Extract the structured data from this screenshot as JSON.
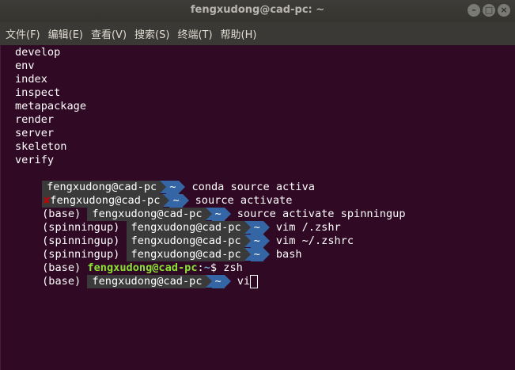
{
  "window": {
    "title": "fengxudong@cad-pc: ~",
    "controls": [
      "–",
      "□",
      "×"
    ]
  },
  "menu": {
    "items": [
      "文件(F)",
      "编辑(E)",
      "查看(V)",
      "搜索(S)",
      "终端(T)",
      "帮助(H)"
    ]
  },
  "terminal": {
    "list_lines": [
      "develop",
      "env",
      "index",
      "inspect",
      "metapackage",
      "render",
      "server",
      "skeleton",
      "verify"
    ],
    "prompt_host": "fengxudong@cad-pc",
    "prompt_dir": "~",
    "error_mark": "✘",
    "plain_prompt_sep": ":",
    "plain_prompt_suffix": "$",
    "cmd1": "conda source activa",
    "cmd2": "source activate",
    "env_base": "(base)",
    "cmd3": "source activate spinningup",
    "env_spin": "(spinningup)",
    "cmd4": "vim /.zshr",
    "cmd5": "vim ~/.zshrc",
    "cmd6": "bash",
    "cmd7": "zsh",
    "cmd8": "vi"
  }
}
